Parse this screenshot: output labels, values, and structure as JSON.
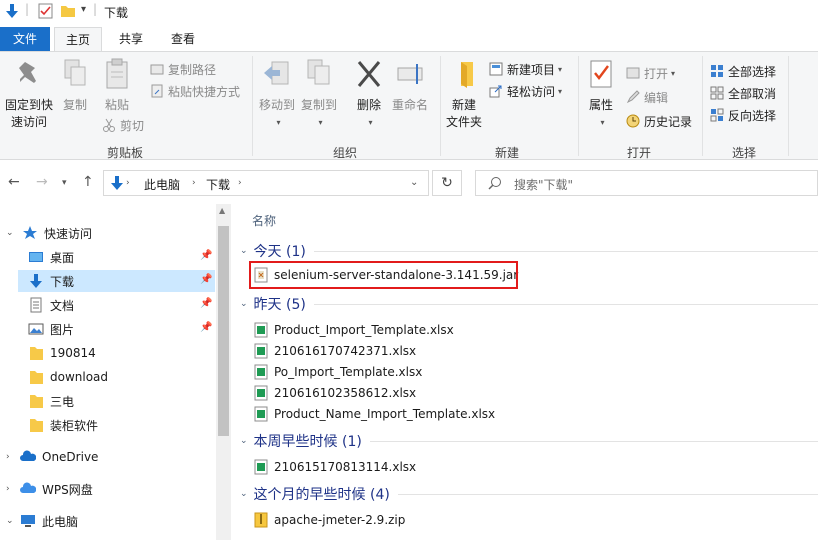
{
  "window": {
    "title": "下载"
  },
  "tabs": {
    "file": "文件",
    "home": "主页",
    "share": "共享",
    "view": "查看"
  },
  "ribbon": {
    "pin_label_1": "固定到快",
    "pin_label_2": "速访问",
    "copy": "复制",
    "paste": "粘贴",
    "copy_path": "复制路径",
    "paste_shortcut": "粘贴快捷方式",
    "cut": "剪切",
    "clipboard_group": "剪贴板",
    "move_to": "移动到",
    "copy_to": "复制到",
    "delete": "删除",
    "rename": "重命名",
    "organize_group": "组织",
    "new_folder_1": "新建",
    "new_folder_2": "文件夹",
    "new_item": "新建项目",
    "easy_access": "轻松访问",
    "new_group": "新建",
    "properties": "属性",
    "open": "打开",
    "edit": "编辑",
    "history": "历史记录",
    "open_group": "打开",
    "select_all": "全部选择",
    "select_none": "全部取消",
    "invert_selection": "反向选择",
    "select_group": "选择"
  },
  "address": {
    "segments": [
      "此电脑",
      "下载"
    ],
    "search_placeholder": "搜索\"下载\""
  },
  "nav": {
    "quick_access": "快速访问",
    "items": [
      {
        "label": "桌面",
        "pinned": true
      },
      {
        "label": "下载",
        "pinned": true,
        "selected": true
      },
      {
        "label": "文档",
        "pinned": true
      },
      {
        "label": "图片",
        "pinned": true
      },
      {
        "label": "190814"
      },
      {
        "label": "download"
      },
      {
        "label": "三电"
      },
      {
        "label": "装柜软件"
      }
    ],
    "onedrive": "OneDrive",
    "wps": "WPS网盘",
    "this_pc": "此电脑"
  },
  "content": {
    "column_name": "名称",
    "groups": [
      {
        "label": "今天 (1)",
        "files": [
          "selenium-server-standalone-3.141.59.jar"
        ]
      },
      {
        "label": "昨天 (5)",
        "files": [
          "Product_Import_Template.xlsx",
          "210616170742371.xlsx",
          "Po_Import_Template.xlsx",
          "210616102358612.xlsx",
          "Product_Name_Import_Template.xlsx"
        ]
      },
      {
        "label": "本周早些时候 (1)",
        "files": [
          "210615170813114.xlsx"
        ]
      },
      {
        "label": "这个月的早些时候 (4)",
        "files": [
          "apache-jmeter-2.9.zip"
        ]
      }
    ]
  },
  "colors": {
    "accent": "#1a6fc9",
    "highlight_box": "#e21b1b",
    "selected_bg": "#cce8ff",
    "group_text": "#1e3287"
  }
}
